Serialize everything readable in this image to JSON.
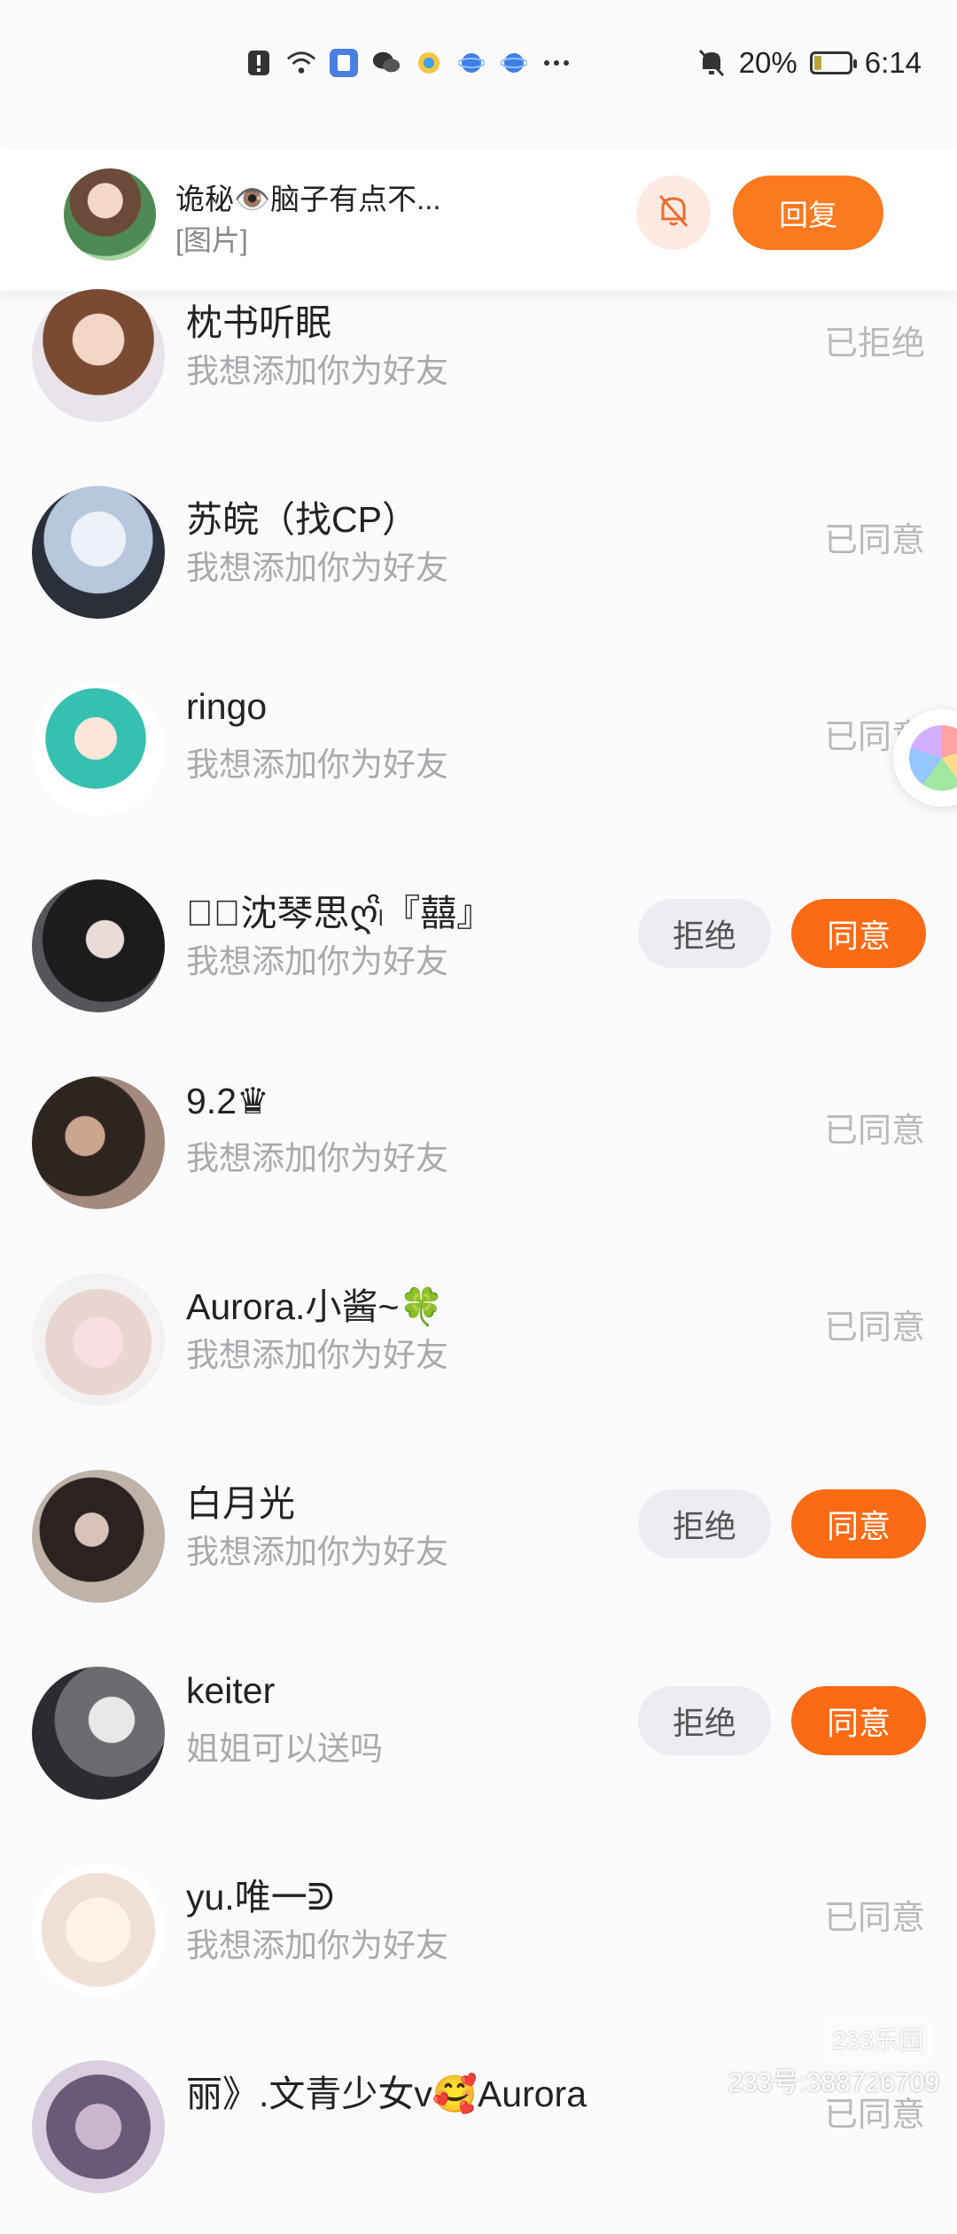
{
  "status_bar": {
    "battery": "20%",
    "battery_level": 0.2,
    "time": "6:14",
    "icons": [
      "alert-icon",
      "wifi-icon",
      "app-icon",
      "wechat-icon",
      "browser-icon",
      "planet-icon",
      "planet-icon",
      "more-dots-icon"
    ]
  },
  "banner": {
    "title": "诡秘👁️脑子有点不...",
    "subtitle": "[图片]",
    "reply_label": "回复"
  },
  "requests": [
    {
      "name": "枕书听眠",
      "message": "我想添加你为好友",
      "status": "已拒绝",
      "pending": false
    },
    {
      "name": "苏皖（找CP）",
      "message": "我想添加你为好友",
      "status": "已同意",
      "pending": false
    },
    {
      "name": "ringo",
      "message": "我想添加你为好友",
      "status": "已同意",
      "pending": false
    },
    {
      "name": "𝓜ꦿ沈琴思ღ၊ᩦ『囍』",
      "message": "我想添加你为好友",
      "status": "",
      "pending": true
    },
    {
      "name": "9.2♛",
      "message": "我想添加你为好友",
      "status": "已同意",
      "pending": false
    },
    {
      "name": "Aurora.小酱~🍀",
      "message": "我想添加你为好友",
      "status": "已同意",
      "pending": false
    },
    {
      "name": "白月光",
      "message": "我想添加你为好友",
      "status": "",
      "pending": true
    },
    {
      "name": "keiter",
      "message": "姐姐可以送吗",
      "status": "",
      "pending": true
    },
    {
      "name": "yu.唯一ᕲ",
      "message": "我想添加你为好友",
      "status": "已同意",
      "pending": false
    },
    {
      "name": "丽》.文青少女v🥰Aurora",
      "message": "",
      "status": "已同意",
      "pending": false
    }
  ],
  "actions": {
    "reject_label": "拒绝",
    "accept_label": "同意"
  },
  "watermark": {
    "logo": "233乐园",
    "text": "233号:388726709"
  },
  "colors": {
    "accent": "#fb6a14",
    "reject_bg": "#ececf2"
  }
}
